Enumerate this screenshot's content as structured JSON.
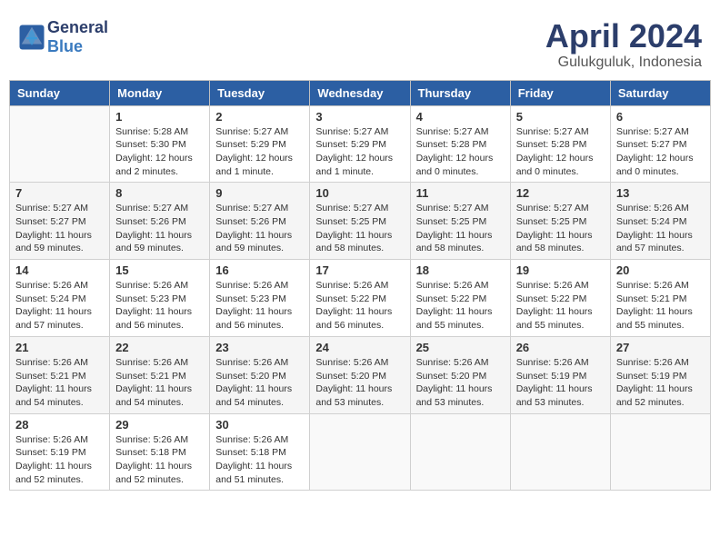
{
  "header": {
    "logo_general": "General",
    "logo_blue": "Blue",
    "month_title": "April 2024",
    "location": "Gulukguluk, Indonesia"
  },
  "weekdays": [
    "Sunday",
    "Monday",
    "Tuesday",
    "Wednesday",
    "Thursday",
    "Friday",
    "Saturday"
  ],
  "weeks": [
    [
      {
        "day": "",
        "info": ""
      },
      {
        "day": "1",
        "info": "Sunrise: 5:28 AM\nSunset: 5:30 PM\nDaylight: 12 hours\nand 2 minutes."
      },
      {
        "day": "2",
        "info": "Sunrise: 5:27 AM\nSunset: 5:29 PM\nDaylight: 12 hours\nand 1 minute."
      },
      {
        "day": "3",
        "info": "Sunrise: 5:27 AM\nSunset: 5:29 PM\nDaylight: 12 hours\nand 1 minute."
      },
      {
        "day": "4",
        "info": "Sunrise: 5:27 AM\nSunset: 5:28 PM\nDaylight: 12 hours\nand 0 minutes."
      },
      {
        "day": "5",
        "info": "Sunrise: 5:27 AM\nSunset: 5:28 PM\nDaylight: 12 hours\nand 0 minutes."
      },
      {
        "day": "6",
        "info": "Sunrise: 5:27 AM\nSunset: 5:27 PM\nDaylight: 12 hours\nand 0 minutes."
      }
    ],
    [
      {
        "day": "7",
        "info": "Sunrise: 5:27 AM\nSunset: 5:27 PM\nDaylight: 11 hours\nand 59 minutes."
      },
      {
        "day": "8",
        "info": "Sunrise: 5:27 AM\nSunset: 5:26 PM\nDaylight: 11 hours\nand 59 minutes."
      },
      {
        "day": "9",
        "info": "Sunrise: 5:27 AM\nSunset: 5:26 PM\nDaylight: 11 hours\nand 59 minutes."
      },
      {
        "day": "10",
        "info": "Sunrise: 5:27 AM\nSunset: 5:25 PM\nDaylight: 11 hours\nand 58 minutes."
      },
      {
        "day": "11",
        "info": "Sunrise: 5:27 AM\nSunset: 5:25 PM\nDaylight: 11 hours\nand 58 minutes."
      },
      {
        "day": "12",
        "info": "Sunrise: 5:27 AM\nSunset: 5:25 PM\nDaylight: 11 hours\nand 58 minutes."
      },
      {
        "day": "13",
        "info": "Sunrise: 5:26 AM\nSunset: 5:24 PM\nDaylight: 11 hours\nand 57 minutes."
      }
    ],
    [
      {
        "day": "14",
        "info": "Sunrise: 5:26 AM\nSunset: 5:24 PM\nDaylight: 11 hours\nand 57 minutes."
      },
      {
        "day": "15",
        "info": "Sunrise: 5:26 AM\nSunset: 5:23 PM\nDaylight: 11 hours\nand 56 minutes."
      },
      {
        "day": "16",
        "info": "Sunrise: 5:26 AM\nSunset: 5:23 PM\nDaylight: 11 hours\nand 56 minutes."
      },
      {
        "day": "17",
        "info": "Sunrise: 5:26 AM\nSunset: 5:22 PM\nDaylight: 11 hours\nand 56 minutes."
      },
      {
        "day": "18",
        "info": "Sunrise: 5:26 AM\nSunset: 5:22 PM\nDaylight: 11 hours\nand 55 minutes."
      },
      {
        "day": "19",
        "info": "Sunrise: 5:26 AM\nSunset: 5:22 PM\nDaylight: 11 hours\nand 55 minutes."
      },
      {
        "day": "20",
        "info": "Sunrise: 5:26 AM\nSunset: 5:21 PM\nDaylight: 11 hours\nand 55 minutes."
      }
    ],
    [
      {
        "day": "21",
        "info": "Sunrise: 5:26 AM\nSunset: 5:21 PM\nDaylight: 11 hours\nand 54 minutes."
      },
      {
        "day": "22",
        "info": "Sunrise: 5:26 AM\nSunset: 5:21 PM\nDaylight: 11 hours\nand 54 minutes."
      },
      {
        "day": "23",
        "info": "Sunrise: 5:26 AM\nSunset: 5:20 PM\nDaylight: 11 hours\nand 54 minutes."
      },
      {
        "day": "24",
        "info": "Sunrise: 5:26 AM\nSunset: 5:20 PM\nDaylight: 11 hours\nand 53 minutes."
      },
      {
        "day": "25",
        "info": "Sunrise: 5:26 AM\nSunset: 5:20 PM\nDaylight: 11 hours\nand 53 minutes."
      },
      {
        "day": "26",
        "info": "Sunrise: 5:26 AM\nSunset: 5:19 PM\nDaylight: 11 hours\nand 53 minutes."
      },
      {
        "day": "27",
        "info": "Sunrise: 5:26 AM\nSunset: 5:19 PM\nDaylight: 11 hours\nand 52 minutes."
      }
    ],
    [
      {
        "day": "28",
        "info": "Sunrise: 5:26 AM\nSunset: 5:19 PM\nDaylight: 11 hours\nand 52 minutes."
      },
      {
        "day": "29",
        "info": "Sunrise: 5:26 AM\nSunset: 5:18 PM\nDaylight: 11 hours\nand 52 minutes."
      },
      {
        "day": "30",
        "info": "Sunrise: 5:26 AM\nSunset: 5:18 PM\nDaylight: 11 hours\nand 51 minutes."
      },
      {
        "day": "",
        "info": ""
      },
      {
        "day": "",
        "info": ""
      },
      {
        "day": "",
        "info": ""
      },
      {
        "day": "",
        "info": ""
      }
    ]
  ]
}
